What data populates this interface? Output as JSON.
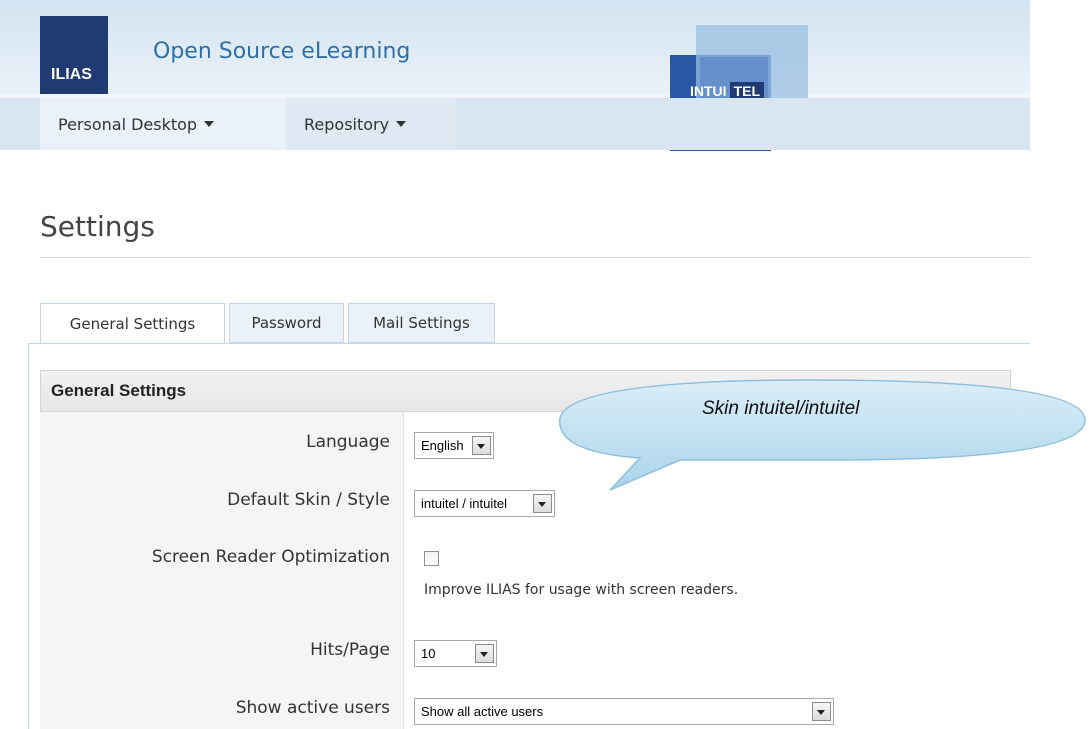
{
  "header": {
    "logo_text": "ILIAS",
    "site_title": "Open Source eLearning",
    "partner_logo": {
      "part1": "INTUI",
      "part2": "TEL"
    }
  },
  "nav": [
    {
      "label": "Personal Desktop",
      "icon": "caret-down-icon"
    },
    {
      "label": "Repository",
      "icon": "caret-down-icon"
    }
  ],
  "page": {
    "title": "Settings"
  },
  "tabs": [
    {
      "label": "General Settings",
      "active": true
    },
    {
      "label": "Password",
      "active": false
    },
    {
      "label": "Mail Settings",
      "active": false
    }
  ],
  "form": {
    "section_title": "General Settings",
    "fields": {
      "language": {
        "label": "Language",
        "value": "English"
      },
      "skin": {
        "label": "Default Skin / Style",
        "value": "intuitel / intuitel"
      },
      "screen_reader": {
        "label": "Screen Reader Optimization",
        "checked": false,
        "help": "Improve ILIAS for usage with screen readers."
      },
      "hits": {
        "label": "Hits/Page",
        "value": "10"
      },
      "active_users": {
        "label": "Show active users",
        "value": "Show all active users"
      }
    }
  },
  "callout": {
    "text": "Skin intuitel/intuitel"
  },
  "colors": {
    "brand_dark": "#1f3b71",
    "link_blue": "#2f6fa6",
    "nav_bg": "#d9e6f2"
  }
}
